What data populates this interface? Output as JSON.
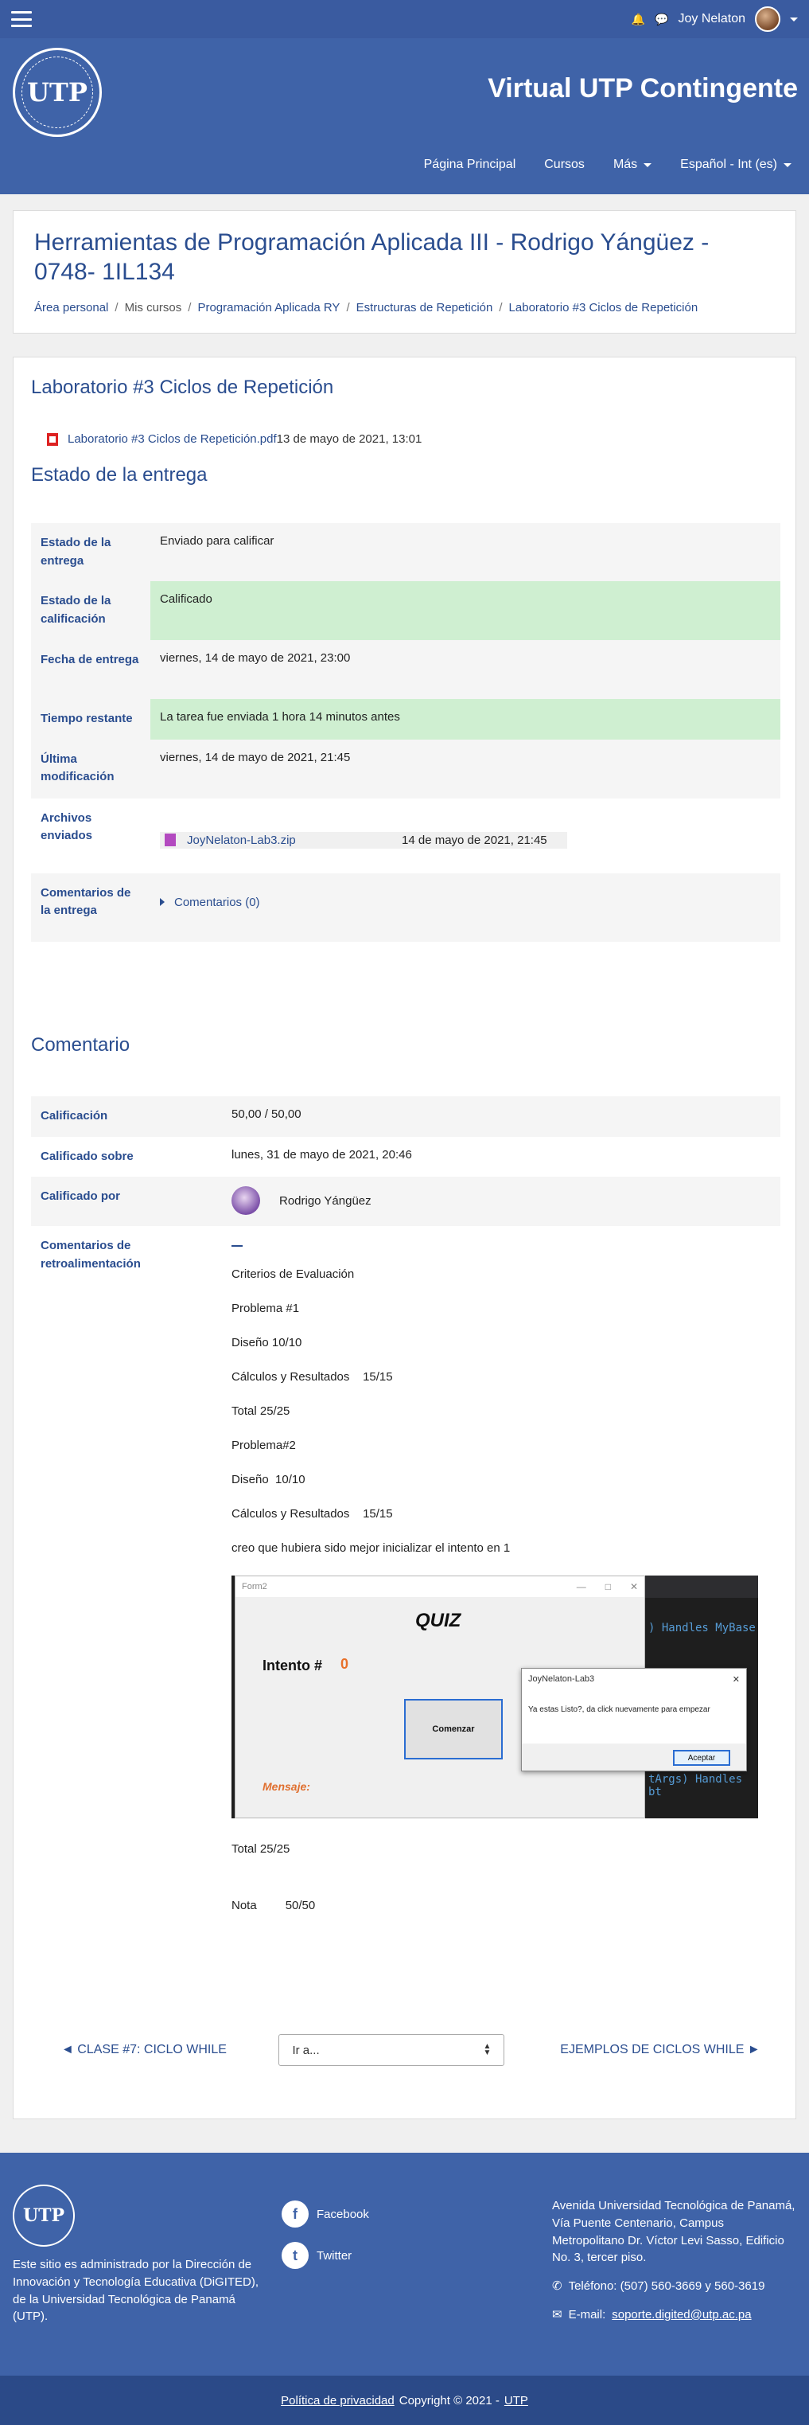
{
  "topbar": {
    "user_name": "Joy Nelaton"
  },
  "header": {
    "logo_text": "UTP",
    "site_title": "Virtual UTP Contingente",
    "nav": [
      {
        "label": "Página Principal",
        "has_caret": false
      },
      {
        "label": "Cursos",
        "has_caret": false
      },
      {
        "label": "Más",
        "has_caret": true
      },
      {
        "label": "Español - Int (es)",
        "has_caret": true
      }
    ]
  },
  "course": {
    "title": "Herramientas de Programación Aplicada III - Rodrigo Yángüez - 0748- 1IL134",
    "breadcrumb": [
      {
        "label": "Área personal",
        "link": true
      },
      {
        "label": "Mis cursos",
        "link": false
      },
      {
        "label": "Programación Aplicada RY",
        "link": true
      },
      {
        "label": "Estructuras de Repetición",
        "link": true
      },
      {
        "label": "Laboratorio #3 Ciclos de Repetición",
        "link": true
      }
    ]
  },
  "assignment": {
    "title": "Laboratorio #3 Ciclos de Repetición",
    "attachment_name": "Laboratorio #3 Ciclos de Repetición.pdf",
    "attachment_date": "13 de mayo de 2021, 13:01",
    "status_heading": "Estado de la entrega",
    "status_rows": [
      {
        "label": "Estado de la entrega",
        "value": "Enviado para calificar"
      },
      {
        "label": "Estado de la calificación",
        "value": "Calificado"
      },
      {
        "label": "Fecha de entrega",
        "value": "viernes, 14 de mayo de 2021, 23:00"
      },
      {
        "label": "Tiempo restante",
        "value": "La tarea fue enviada 1 hora 14 minutos antes"
      },
      {
        "label": "Última modificación",
        "value": "viernes, 14 de mayo de 2021, 21:45"
      },
      {
        "label": "Archivos enviados",
        "file_name": "JoyNelaton-Lab3.zip",
        "file_date": "14 de mayo de 2021, 21:45"
      },
      {
        "label": "Comentarios de la entrega",
        "value": "Comentarios (0)"
      }
    ]
  },
  "feedback": {
    "heading": "Comentario",
    "grade_label": "Calificación",
    "grade_value": "50,00 / 50,00",
    "graded_on_label": "Calificado sobre",
    "graded_on_value": "lunes, 31 de mayo de 2021, 20:46",
    "graded_by_label": "Calificado por",
    "graded_by_value": "Rodrigo Yángüez",
    "comments_label": "Comentarios de retroalimentación",
    "lines": [
      "Criterios de Evaluación",
      "Problema #1",
      "Diseño 10/10",
      "Cálculos y Resultados    15/15",
      "Total 25/25",
      "Problema#2",
      "Diseño  10/10",
      "Cálculos y Resultados    15/15",
      "creo que hubiera sido mejor inicializar el intento en 1"
    ],
    "after_image_total": "Total 25/25",
    "nota_label": "Nota",
    "nota_value": "50/50",
    "screenshot": {
      "window_title": "Form2",
      "quiz_title": "QUIZ",
      "intento_label": "Intento #",
      "intento_value": "0",
      "start_button": "Comenzar",
      "message_label": "Mensaje:",
      "code_line_1": ") Handles MyBase",
      "code_line_2": "tArgs) Handles bt",
      "dialog_title": "JoyNelaton-Lab3",
      "dialog_message": "Ya estas Listo?, da click nuevamente para empezar",
      "dialog_button": "Aceptar"
    }
  },
  "activity_nav": {
    "prev": "◄ CLASE #7: CICLO WHILE",
    "jump_placeholder": "Ir a...",
    "next": "EJEMPLOS DE CICLOS WHILE ►"
  },
  "footer": {
    "admin_text": "Este sitio es administrado por la Dirección de Innovación y Tecnología Educativa (DiGITED), de la Universidad Tecnológica de Panamá (UTP).",
    "social": [
      {
        "label": "Facebook",
        "icon": "f"
      },
      {
        "label": "Twitter",
        "icon": "t"
      }
    ],
    "address": "Avenida Universidad Tecnológica de Panamá, Vía Puente Centenario, Campus Metropolitano Dr. Víctor Levi Sasso, Edificio No. 3, tercer piso.",
    "phone": "Teléfono: (507) 560-3669 y 560-3619",
    "email_label": "E-mail:",
    "email": "soporte.digited@utp.ac.pa",
    "privacy": "Política de privacidad",
    "copyright": "Copyright © 2021 -",
    "copyright_link": "UTP"
  },
  "colors": {
    "brand_blue": "#3f63a8",
    "link_blue": "#2a4d8f",
    "status_green": "#cfefd1"
  }
}
